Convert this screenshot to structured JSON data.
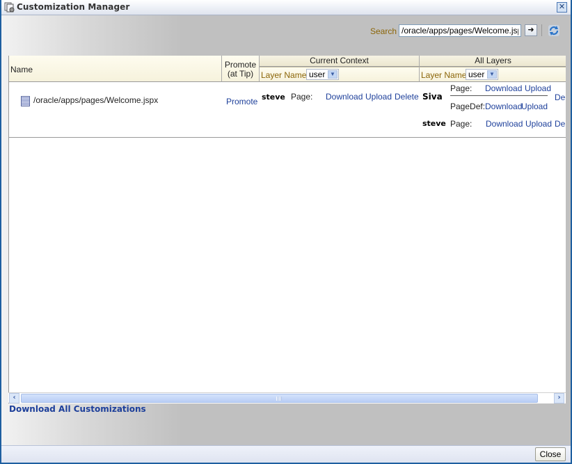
{
  "window": {
    "title": "Customization Manager",
    "close_icon": "close-x-icon"
  },
  "search": {
    "label": "Search",
    "value": "/oracle/apps/pages/Welcome.jspx",
    "go_icon": "arrow-right-icon",
    "refresh_icon": "refresh-icon"
  },
  "table": {
    "columns": {
      "name": "Name",
      "promote_line1": "Promote",
      "promote_line2": "(at Tip)",
      "current_context": "Current Context",
      "all_layers": "All Layers"
    },
    "current_context_filter": {
      "label": "Layer Name",
      "selected": "user"
    },
    "all_layers_filter": {
      "label": "Layer Name",
      "selected": "user"
    },
    "rows": [
      {
        "name": "/oracle/apps/pages/Welcome.jspx",
        "promote": "Promote",
        "current_context": {
          "user": "steve",
          "type": "Page:",
          "actions": [
            "Download",
            "Upload",
            "Delete"
          ]
        },
        "all_layers": [
          {
            "user": "Siva",
            "entries": [
              {
                "type": "Page:",
                "actions": [
                  "Download",
                  "Upload"
                ]
              },
              {
                "type": "PageDef:",
                "actions": [
                  "Download",
                  "Upload"
                ]
              }
            ],
            "delete": "Delete"
          },
          {
            "user": "steve",
            "entries": [
              {
                "type": "Page:",
                "actions": [
                  "Download",
                  "Upload"
                ]
              }
            ],
            "delete": "Delete"
          }
        ]
      }
    ]
  },
  "download_all": "Download All Customizations",
  "footer": {
    "close": "Close"
  }
}
